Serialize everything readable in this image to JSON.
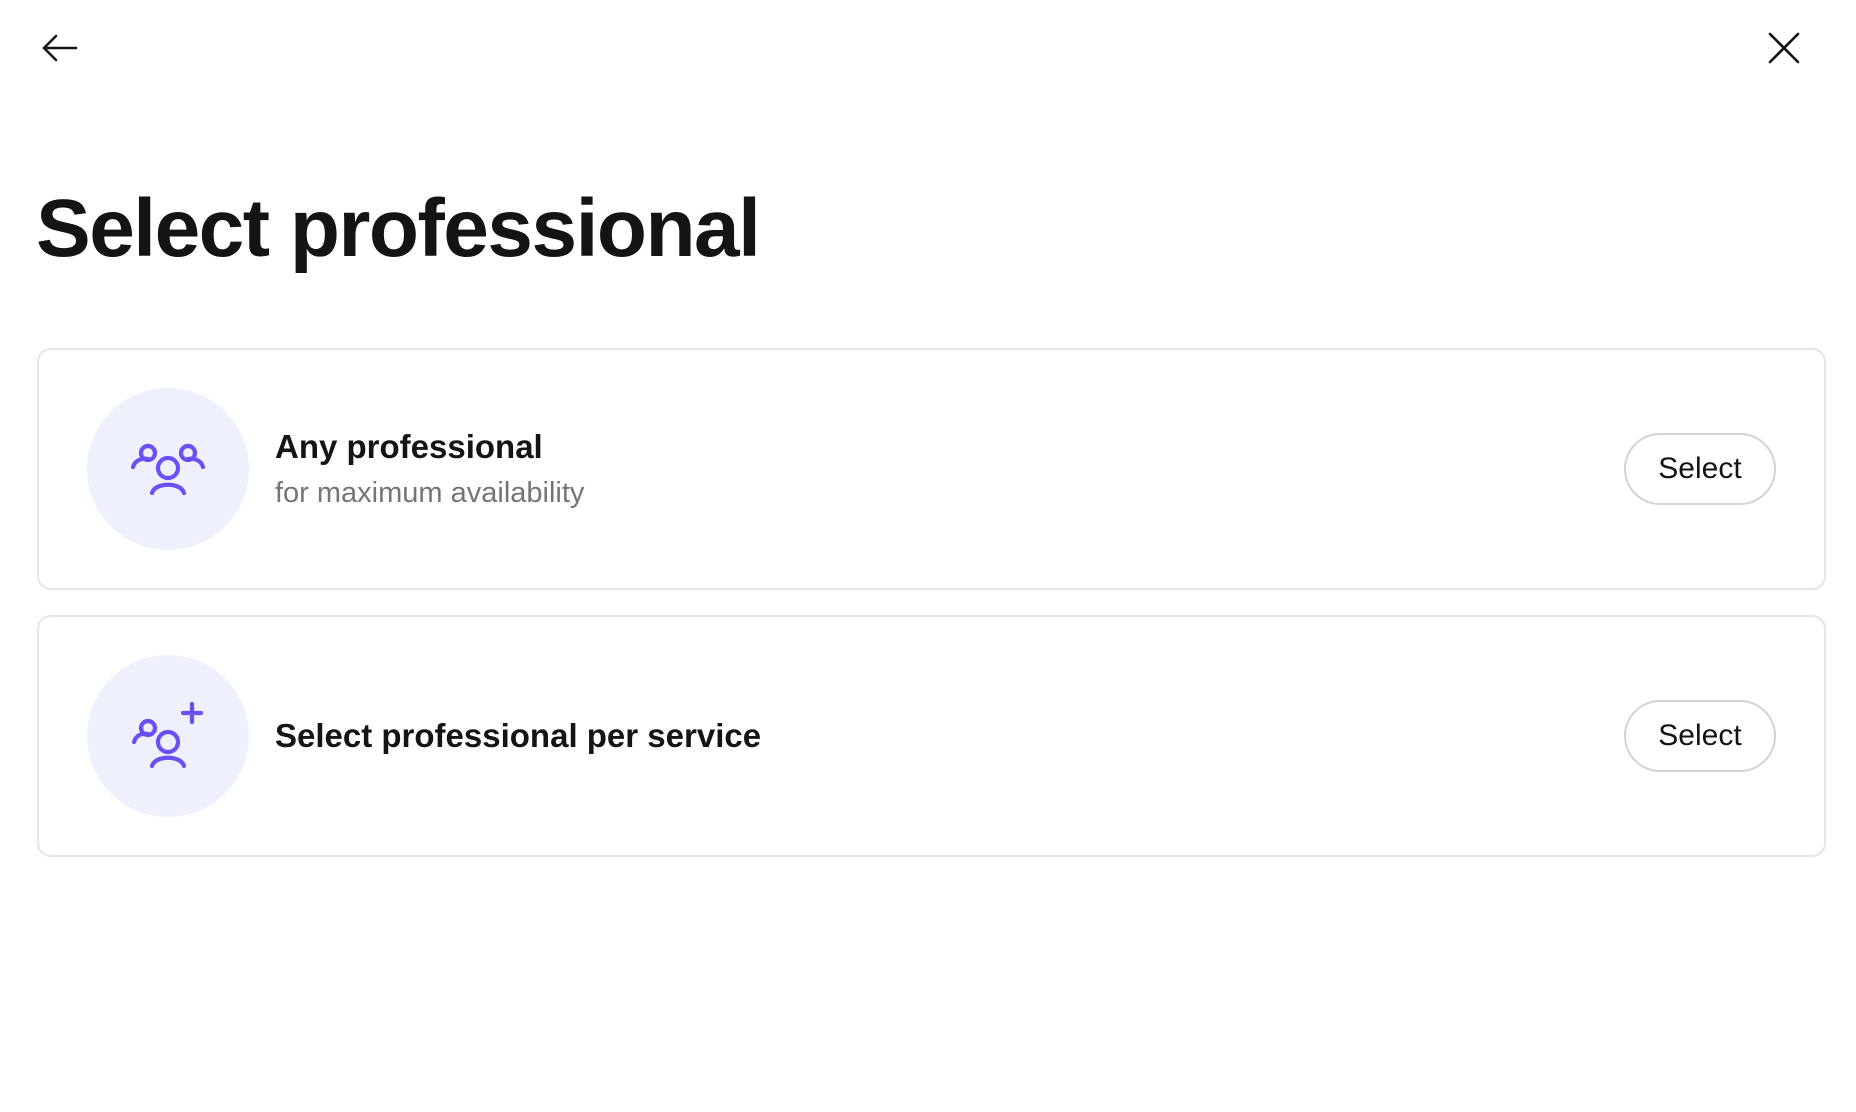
{
  "header": {
    "back_icon": "arrow-left-icon",
    "close_icon": "close-icon"
  },
  "page": {
    "title": "Select professional"
  },
  "options": [
    {
      "icon": "group-people-icon",
      "title": "Any professional",
      "subtitle": "for maximum availability",
      "button_label": "Select"
    },
    {
      "icon": "people-add-icon",
      "title": "Select professional per service",
      "button_label": "Select"
    }
  ],
  "colors": {
    "accent": "#6950f3",
    "avatar_bg": "#eef0fd",
    "text": "#141414",
    "muted_text": "#757575",
    "border": "#e5e5e5"
  }
}
